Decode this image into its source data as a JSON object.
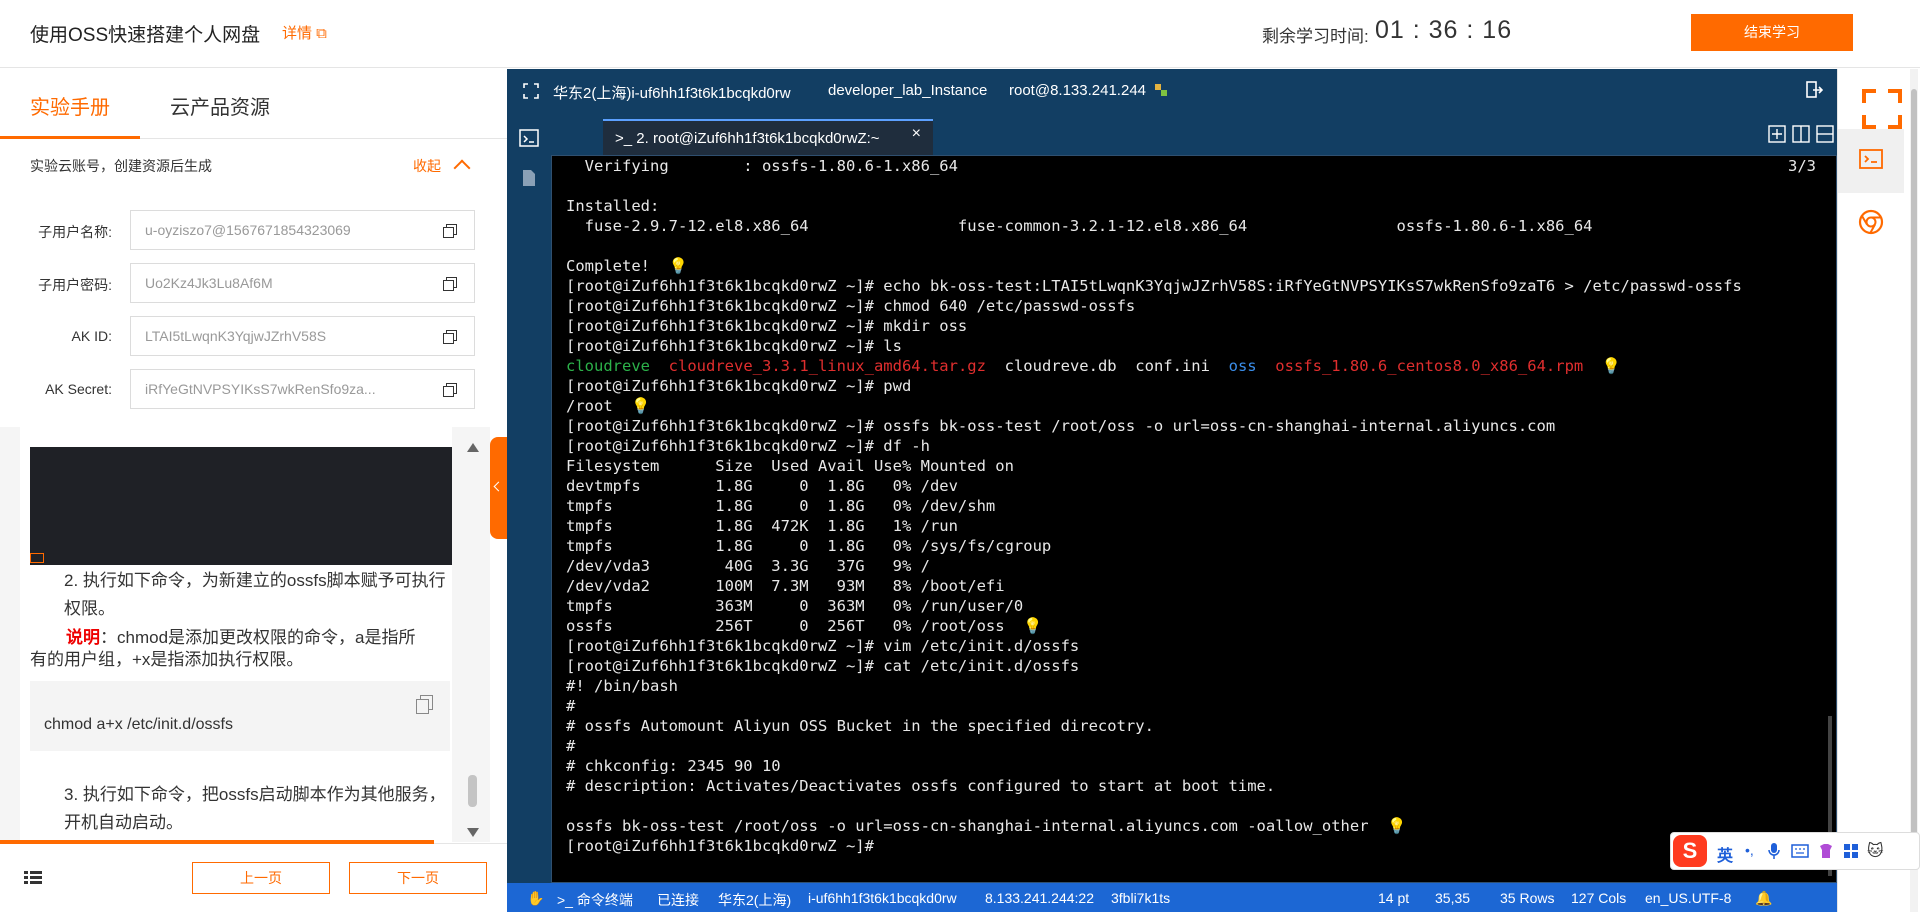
{
  "header": {
    "title": "使用OSS快速搭建个人网盘",
    "detail": "详情",
    "timer_label": "剩余学习时间:",
    "timer": "01 : 36 : 16",
    "end_button": "结束学习"
  },
  "tabs": {
    "active": "实验手册",
    "inactive": "云产品资源"
  },
  "credentials": {
    "note": "实验云账号，创建资源后生成",
    "collapse": "收起",
    "fields": [
      {
        "label": "子用户名称:",
        "value": "u-oyziszo7@1567671854323069"
      },
      {
        "label": "子用户密码:",
        "value": "Uo2Kz4Jk3Lu8Af6M"
      },
      {
        "label": "AK ID:",
        "value": "LTAI5tLwqnK3YqjwJZrhV58S"
      },
      {
        "label": "AK Secret:",
        "value": "iRfYeGtNVPSYIKsS7wkRenSfo9za..."
      }
    ]
  },
  "manual": {
    "step2": "2. 执行如下命令，为新建立的ossfs脚本赋予可执行",
    "step2b": "权限。",
    "explain_kw": "说明",
    "explain": "：chmod是添加更改权限的命令，a是指所",
    "explain2": "有的用户组，+x是指添加执行权限。",
    "code": "chmod a+x /etc/init.d/ossfs",
    "step3": "3. 执行如下命令，把ossfs启动脚本作为其他服务，",
    "step3b": "开机自动启动。"
  },
  "footer": {
    "prev": "上一页",
    "next": "下一页"
  },
  "terminal": {
    "topbar": {
      "region": "华东2(上海)i-uf6hh1f3t6k1bcqkd0rw",
      "instance": "developer_lab_Instance",
      "login": "root@8.133.241.244"
    },
    "tab_title": ">_ 2. root@iZuf6hh1f3t6k1bcqkd0rwZ:~",
    "tab_close": "×",
    "counter": "3/3",
    "lines": [
      "  Verifying        : ossfs-1.80.6-1.x86_64",
      "",
      "Installed:",
      "  fuse-2.9.7-12.el8.x86_64                fuse-common-3.2.1-12.el8.x86_64                ossfs-1.80.6-1.x86_64",
      "",
      "Complete!",
      "[root@iZuf6hh1f3t6k1bcqkd0rwZ ~]# echo bk-oss-test:LTAI5tLwqnK3YqjwJZrhV58S:iRfYeGtNVPSYIKsS7wkRenSfo9zaT6 > /etc/passwd-ossfs",
      "[root@iZuf6hh1f3t6k1bcqkd0rwZ ~]# chmod 640 /etc/passwd-ossfs",
      "[root@iZuf6hh1f3t6k1bcqkd0rwZ ~]# mkdir oss",
      "[root@iZuf6hh1f3t6k1bcqkd0rwZ ~]# ls",
      "LS_LINE",
      "[root@iZuf6hh1f3t6k1bcqkd0rwZ ~]# pwd",
      "/root",
      "[root@iZuf6hh1f3t6k1bcqkd0rwZ ~]# ossfs bk-oss-test /root/oss -o url=oss-cn-shanghai-internal.aliyuncs.com",
      "[root@iZuf6hh1f3t6k1bcqkd0rwZ ~]# df -h",
      "Filesystem      Size  Used Avail Use% Mounted on",
      "devtmpfs        1.8G     0  1.8G   0% /dev",
      "tmpfs           1.8G     0  1.8G   0% /dev/shm",
      "tmpfs           1.8G  472K  1.8G   1% /run",
      "tmpfs           1.8G     0  1.8G   0% /sys/fs/cgroup",
      "/dev/vda3        40G  3.3G   37G   9% /",
      "/dev/vda2       100M  7.3M   93M   8% /boot/efi",
      "tmpfs           363M     0  363M   0% /run/user/0",
      "ossfs           256T     0  256T   0% /root/oss",
      "[root@iZuf6hh1f3t6k1bcqkd0rwZ ~]# vim /etc/init.d/ossfs",
      "[root@iZuf6hh1f3t6k1bcqkd0rwZ ~]# cat /etc/init.d/ossfs",
      "#! /bin/bash",
      "#",
      "# ossfs Automount Aliyun OSS Bucket in the specified direcotry.",
      "#",
      "# chkconfig: 2345 90 10",
      "# description: Activates/Deactivates ossfs configured to start at boot time.",
      "",
      "ossfs bk-oss-test /root/oss -o url=oss-cn-shanghai-internal.aliyuncs.com -oallow_other",
      "[root@iZuf6hh1f3t6k1bcqkd0rwZ ~]#"
    ],
    "ls_items": [
      {
        "text": "cloudreve",
        "color": "green"
      },
      {
        "text": "cloudreve_3.3.1_linux_amd64.tar.gz",
        "color": "red"
      },
      {
        "text": "cloudreve.db",
        "color": "white"
      },
      {
        "text": "conf.ini",
        "color": "white"
      },
      {
        "text": "oss",
        "color": "blue"
      },
      {
        "text": "ossfs_1.80.6_centos8.0_x86_64.rpm",
        "color": "red"
      }
    ],
    "status": {
      "terminal": "命令终端",
      "connected": "已连接",
      "region": "华东2(上海)",
      "instance": "i-uf6hh1f3t6k1bcqkd0rw",
      "ip": "8.133.241.244:22",
      "session": "3fbli7k1ts",
      "font": "14 pt",
      "cursor": "35,35",
      "rows": "35 Rows",
      "cols": "127 Cols",
      "encoding": "en_US.UTF-8"
    }
  },
  "ime": {
    "logo": "S",
    "mode": "英"
  }
}
